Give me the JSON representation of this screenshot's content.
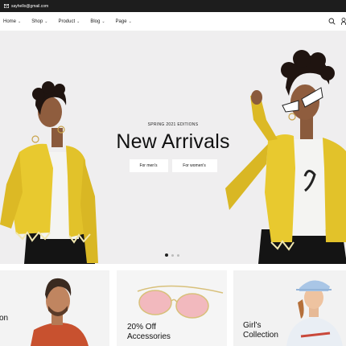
{
  "topbar": {
    "email": "sayhello@gmail.com"
  },
  "nav": {
    "items": [
      {
        "label": "Home"
      },
      {
        "label": "Shop"
      },
      {
        "label": "Product"
      },
      {
        "label": "Blog"
      },
      {
        "label": "Page"
      }
    ],
    "chevron": "⌄",
    "icons": [
      "search-icon",
      "user-icon"
    ]
  },
  "hero": {
    "kicker": "SPRING 2021 EDITIONS",
    "title": "New Arrivals",
    "buttons": [
      {
        "label": "For men's"
      },
      {
        "label": "For women's"
      }
    ],
    "slides": 3,
    "active_slide": 1
  },
  "cards": [
    {
      "line1": "on",
      "line2": ""
    },
    {
      "line1": "20% Off",
      "line2": "Accessories"
    },
    {
      "line1": "Girl's",
      "line2": "Collection"
    }
  ],
  "colors": {
    "topbar": "#1d1d1d",
    "hero_bg": "#efeeef",
    "jacket": "#e8c92f"
  }
}
